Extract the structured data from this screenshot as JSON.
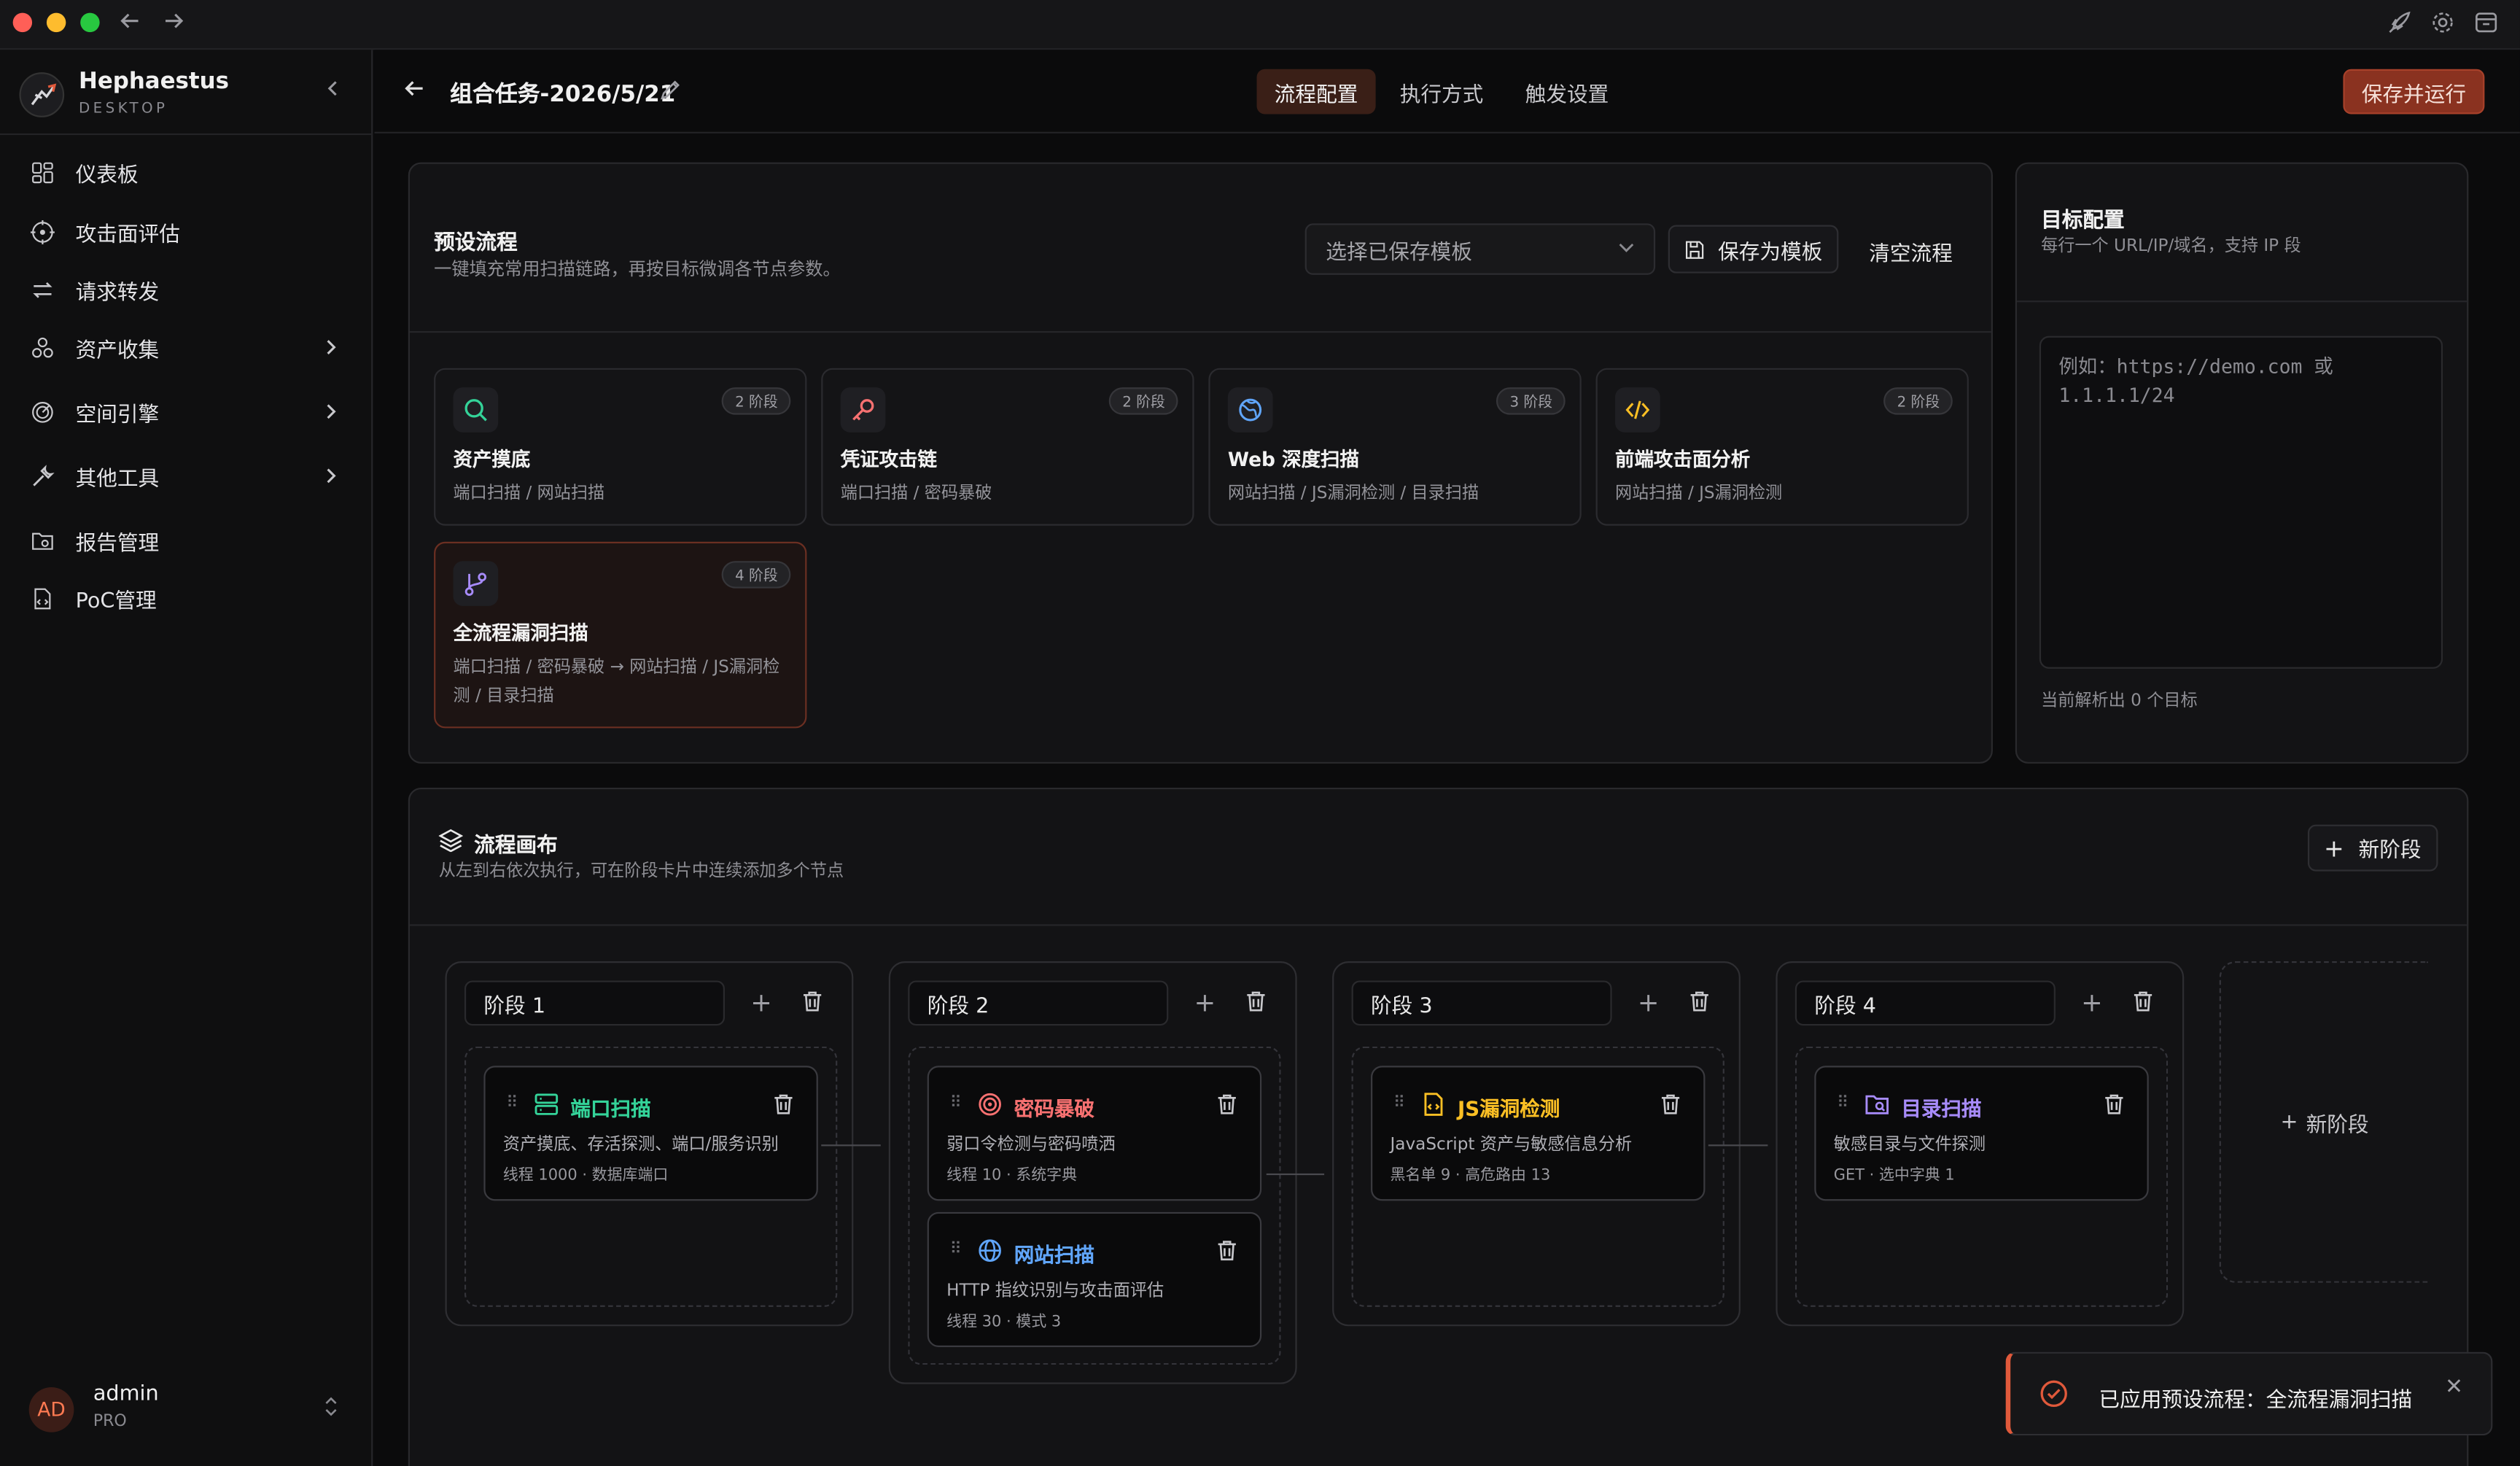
{
  "brand": {
    "name": "Hephaestus",
    "sub": "DESKTOP"
  },
  "sidebar": {
    "items": [
      {
        "label": "仪表板",
        "icon": "dashboard-icon"
      },
      {
        "label": "攻击面评估",
        "icon": "target-icon"
      },
      {
        "label": "请求转发",
        "icon": "repeat-icon"
      },
      {
        "label": "资产收集",
        "icon": "cluster-icon",
        "expandable": true
      },
      {
        "label": "空间引擎",
        "icon": "radar-icon",
        "expandable": true
      },
      {
        "label": "其他工具",
        "icon": "wrench-icon",
        "expandable": true
      },
      {
        "label": "报告管理",
        "icon": "folder-search-icon"
      },
      {
        "label": "PoC管理",
        "icon": "file-code-icon"
      }
    ]
  },
  "user": {
    "initials": "AD",
    "name": "admin",
    "plan": "PRO"
  },
  "header": {
    "title": "组合任务-2026/5/21",
    "tabs": [
      {
        "label": "流程配置",
        "active": true
      },
      {
        "label": "执行方式",
        "active": false
      },
      {
        "label": "触发设置",
        "active": false
      }
    ],
    "run_label": "保存并运行"
  },
  "presets": {
    "title": "预设流程",
    "subtitle": "一键填充常用扫描链路，再按目标微调各节点参数。",
    "select_placeholder": "选择已保存模板",
    "save_template_label": "保存为模板",
    "clear_label": "清空流程",
    "cards": [
      {
        "name": "资产摸底",
        "badge": "2 阶段",
        "desc": "端口扫描 / 网站扫描",
        "icon": "search-icon",
        "color": "#34d399"
      },
      {
        "name": "凭证攻击链",
        "badge": "2 阶段",
        "desc": "端口扫描 / 密码暴破",
        "icon": "key-icon",
        "color": "#f87171"
      },
      {
        "name": "Web 深度扫描",
        "badge": "3 阶段",
        "desc": "网站扫描 / JS漏洞检测 / 目录扫描",
        "icon": "globe-icon",
        "color": "#60a5fa"
      },
      {
        "name": "前端攻击面分析",
        "badge": "2 阶段",
        "desc": "网站扫描 / JS漏洞检测",
        "icon": "code-icon",
        "color": "#fbbf24"
      },
      {
        "name": "全流程漏洞扫描",
        "badge": "4 阶段",
        "desc": "端口扫描 / 密码暴破 → 网站扫描 / JS漏洞检测 / 目录扫描",
        "icon": "git-branch-icon",
        "color": "#a78bfa",
        "selected": true
      }
    ]
  },
  "target": {
    "title": "目标配置",
    "subtitle": "每行一个 URL/IP/域名，支持 IP 段",
    "placeholder": "例如：https://demo.com 或\n1.1.1.1/24",
    "count_text": "当前解析出 0 个目标"
  },
  "canvas": {
    "title": "流程画布",
    "subtitle": "从左到右依次执行，可在阶段卡片中连续添加多个节点",
    "new_stage_label": "新阶段",
    "ghost_label": "新阶段",
    "stages": [
      {
        "name": "阶段 1",
        "nodes": [
          {
            "name": "端口扫描",
            "desc": "资产摸底、存活探测、端口/服务识别",
            "meta": "线程 1000 · 数据库端口",
            "icon": "server-icon",
            "color": "#34d399"
          }
        ]
      },
      {
        "name": "阶段 2",
        "nodes": [
          {
            "name": "密码暴破",
            "desc": "弱口令检测与密码喷洒",
            "meta": "线程 10 · 系统字典",
            "icon": "target-icon",
            "color": "#f87171"
          },
          {
            "name": "网站扫描",
            "desc": "HTTP 指纹识别与攻击面评估",
            "meta": "线程 30 · 模式 3",
            "icon": "globe-icon",
            "color": "#60a5fa"
          }
        ]
      },
      {
        "name": "阶段 3",
        "nodes": [
          {
            "name": "JS漏洞检测",
            "desc": "JavaScript 资产与敏感信息分析",
            "meta": "黑名单 9 · 高危路由 13",
            "icon": "file-code-icon",
            "color": "#fbbf24"
          }
        ]
      },
      {
        "name": "阶段 4",
        "nodes": [
          {
            "name": "目录扫描",
            "desc": "敏感目录与文件探测",
            "meta": "GET · 选中字典 1",
            "icon": "folder-search-icon",
            "color": "#a78bfa"
          }
        ]
      }
    ]
  },
  "toast": {
    "text": "已应用预设流程：全流程漏洞扫描"
  }
}
